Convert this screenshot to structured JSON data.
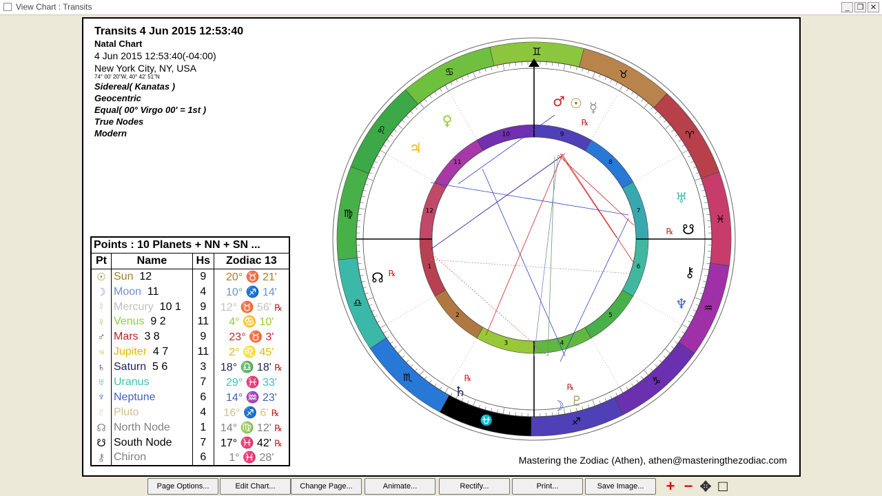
{
  "window": {
    "title": "View Chart : Transits",
    "min": "_",
    "restore": "❐",
    "close": "✕"
  },
  "header": {
    "title": "Transits 4 Jun 2015 12:53:40",
    "chart_kind": "Natal Chart",
    "datetime": "4 Jun 2015 12:53:40(-04:00)",
    "place": "New York City, NY, USA",
    "coords": "74° 00' 20\"W, 40° 42' 51\"N",
    "settings": [
      "Sidereal( Kanatas )",
      "Geocentric",
      "Equal( 00° Virgo 00' = 1st )",
      "True Nodes",
      "Modern"
    ]
  },
  "points_table": {
    "caption": "Points : 10 Planets + NN + SN ...",
    "headers": [
      "Pt",
      "Name",
      "Hs",
      "Zodiac 13"
    ],
    "rows": [
      {
        "glyph": "☉",
        "name": "Sun",
        "aspects": "12",
        "hs": "9",
        "deg": "20°",
        "sign": "♉",
        "min": "21'",
        "rx": "",
        "color": "#a08020"
      },
      {
        "glyph": "☽",
        "name": "Moon",
        "aspects": "11",
        "hs": "4",
        "deg": "10°",
        "sign": "♐",
        "min": "14'",
        "rx": "",
        "color": "#7090d0"
      },
      {
        "glyph": "☿",
        "name": "Mercury",
        "aspects": "10 1",
        "hs": "9",
        "deg": "12°",
        "sign": "♉",
        "min": "56'",
        "rx": "℞",
        "color": "#c0c0c0"
      },
      {
        "glyph": "♀",
        "name": "Venus",
        "aspects": "9  2",
        "hs": "11",
        "deg": "4°",
        "sign": "♋",
        "min": "10'",
        "rx": "",
        "color": "#8fce2a"
      },
      {
        "glyph": "♂",
        "name": "Mars",
        "aspects": "3 8",
        "hs": "9",
        "deg": "23°",
        "sign": "♉",
        "min": "3'",
        "rx": "",
        "color": "#c8202a"
      },
      {
        "glyph": "♃",
        "name": "Jupiter",
        "aspects": "4 7",
        "hs": "11",
        "deg": "2°",
        "sign": "♌",
        "min": "45'",
        "rx": "",
        "color": "#e0b800"
      },
      {
        "glyph": "♄",
        "name": "Saturn",
        "aspects": "5  6",
        "hs": "3",
        "deg": "18°",
        "sign": "♎",
        "min": "18'",
        "rx": "℞",
        "color": "#20205a"
      },
      {
        "glyph": "♅",
        "name": "Uranus",
        "aspects": "",
        "hs": "7",
        "deg": "29°",
        "sign": "♓",
        "min": "33'",
        "rx": "",
        "color": "#40c0b0"
      },
      {
        "glyph": "♆",
        "name": "Neptune",
        "aspects": "",
        "hs": "6",
        "deg": "14°",
        "sign": "♒",
        "min": "23'",
        "rx": "",
        "color": "#4060c0"
      },
      {
        "glyph": "♇",
        "name": "Pluto",
        "aspects": "",
        "hs": "4",
        "deg": "16°",
        "sign": "♐",
        "min": "6'",
        "rx": "℞",
        "color": "#d0c090"
      },
      {
        "glyph": "☊",
        "name": "North Node",
        "aspects": "",
        "hs": "1",
        "deg": "14°",
        "sign": "♍",
        "min": "12'",
        "rx": "℞",
        "color": "#808080"
      },
      {
        "glyph": "☋",
        "name": "South Node",
        "aspects": "",
        "hs": "7",
        "deg": "17°",
        "sign": "♓",
        "min": "42'",
        "rx": "℞",
        "color": "#000000"
      },
      {
        "glyph": "⚷",
        "name": "Chiron",
        "aspects": "",
        "hs": "6",
        "deg": "1°",
        "sign": "♓",
        "min": "28'",
        "rx": "",
        "color": "#808080"
      }
    ]
  },
  "credit": "Mastering the Zodiac (Athen), athen@masteringthezodiac.com",
  "wheel": {
    "signs": [
      {
        "glyph": "♊",
        "color": "#8cc63f"
      },
      {
        "glyph": "♉",
        "color": "#b8844c"
      },
      {
        "glyph": "♈",
        "color": "#b8404a"
      },
      {
        "glyph": "♓",
        "color": "#c83c6c"
      },
      {
        "glyph": "♒",
        "color": "#a030a8"
      },
      {
        "glyph": "♑",
        "color": "#6a30b0"
      },
      {
        "glyph": "♐",
        "color": "#5040b8"
      },
      {
        "glyph": "⛎",
        "color": "#000000"
      },
      {
        "glyph": "♏",
        "color": "#2878d8"
      },
      {
        "glyph": "♎",
        "color": "#3cb8a8"
      },
      {
        "glyph": "♍",
        "color": "#48b048"
      },
      {
        "glyph": "♌",
        "color": "#3ca848"
      },
      {
        "glyph": "♋",
        "color": "#70c040"
      }
    ],
    "houses": [
      "1",
      "2",
      "3",
      "4",
      "5",
      "6",
      "7",
      "8",
      "9",
      "10",
      "11",
      "12"
    ],
    "house_colors": [
      "#b84050",
      "#b07840",
      "#98c838",
      "#60b840",
      "#48b048",
      "#40b8a0",
      "#38a8b0",
      "#2878d8",
      "#5040b8",
      "#7030b0",
      "#a838a8",
      "#c04868"
    ],
    "transit_planets": [
      {
        "glyph": "♂",
        "color": "#c8202a"
      },
      {
        "glyph": "☉",
        "color": "#a08020"
      },
      {
        "glyph": "☿",
        "color": "#909090"
      },
      {
        "glyph": "♀",
        "color": "#8fce2a"
      },
      {
        "glyph": "♃",
        "color": "#e0b800"
      },
      {
        "glyph": "♅",
        "color": "#40c0b0"
      },
      {
        "glyph": "☋",
        "color": "#000000"
      },
      {
        "glyph": "⚷",
        "color": "#000000"
      },
      {
        "glyph": "♆",
        "color": "#4060c0"
      },
      {
        "glyph": "☊",
        "color": "#000000"
      },
      {
        "glyph": "♄",
        "color": "#20205a"
      },
      {
        "glyph": "☽",
        "color": "#4060c0"
      },
      {
        "glyph": "♇",
        "color": "#b0a070"
      }
    ],
    "retro_marks": [
      "℞",
      "℞",
      "℞",
      "℞",
      "℞"
    ]
  },
  "buttons": [
    "Page Options...",
    "Edit Chart...",
    "Change Page...",
    "Animate...",
    "Rectify...",
    "Print...",
    "Save Image..."
  ],
  "zoom_tools": [
    {
      "glyph": "+",
      "color": "#d01010"
    },
    {
      "glyph": "−",
      "color": "#d01010"
    },
    {
      "glyph": "✥",
      "color": "#333333"
    },
    {
      "glyph": "□",
      "color": "#000000"
    }
  ]
}
